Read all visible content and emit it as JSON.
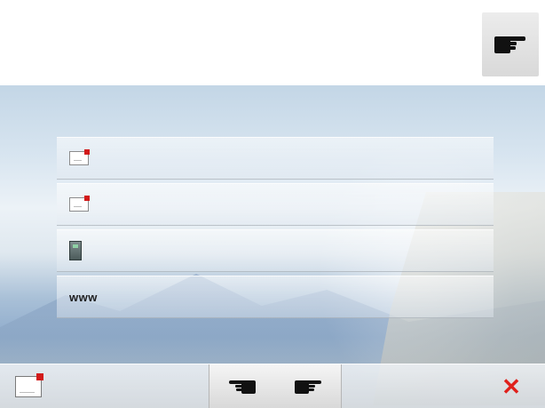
{
  "top": {
    "hand_icon": "pointing-hand-right-icon"
  },
  "menu": {
    "items": [
      {
        "icon": "envelope-icon",
        "label": ""
      },
      {
        "icon": "envelope-icon",
        "label": ""
      },
      {
        "icon": "phone-icon",
        "label": ""
      },
      {
        "icon": "none",
        "label": "www"
      }
    ]
  },
  "bottom_bar": {
    "envelope_icon": "envelope-icon",
    "prev_icon": "pointing-hand-left-icon",
    "next_icon": "pointing-hand-right-icon",
    "close_label": "✕",
    "close_color": "#e0211c"
  }
}
